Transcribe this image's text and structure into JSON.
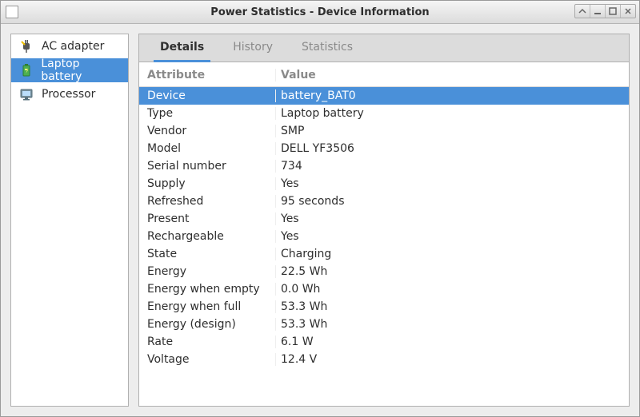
{
  "window": {
    "title": "Power Statistics - Device Information"
  },
  "sidebar": {
    "items": [
      {
        "id": "ac-adapter",
        "label": "AC adapter",
        "selected": false,
        "icon": "plug-icon"
      },
      {
        "id": "laptop-battery",
        "label": "Laptop battery",
        "selected": true,
        "icon": "battery-icon"
      },
      {
        "id": "processor",
        "label": "Processor",
        "selected": false,
        "icon": "monitor-icon"
      }
    ]
  },
  "tabs": [
    {
      "id": "details",
      "label": "Details",
      "active": true
    },
    {
      "id": "history",
      "label": "History",
      "active": false
    },
    {
      "id": "statistics",
      "label": "Statistics",
      "active": false
    }
  ],
  "headers": {
    "attribute": "Attribute",
    "value": "Value"
  },
  "rows": [
    {
      "attr": "Device",
      "val": "battery_BAT0",
      "selected": true
    },
    {
      "attr": "Type",
      "val": "Laptop battery"
    },
    {
      "attr": "Vendor",
      "val": "SMP"
    },
    {
      "attr": "Model",
      "val": "DELL YF3506"
    },
    {
      "attr": "Serial number",
      "val": "734"
    },
    {
      "attr": "Supply",
      "val": "Yes"
    },
    {
      "attr": "Refreshed",
      "val": "95 seconds"
    },
    {
      "attr": "Present",
      "val": "Yes"
    },
    {
      "attr": "Rechargeable",
      "val": "Yes"
    },
    {
      "attr": "State",
      "val": "Charging"
    },
    {
      "attr": "Energy",
      "val": "22.5 Wh"
    },
    {
      "attr": "Energy when empty",
      "val": "0.0 Wh"
    },
    {
      "attr": "Energy when full",
      "val": "53.3 Wh"
    },
    {
      "attr": "Energy (design)",
      "val": "53.3 Wh"
    },
    {
      "attr": "Rate",
      "val": "6.1 W"
    },
    {
      "attr": "Voltage",
      "val": "12.4 V"
    }
  ]
}
